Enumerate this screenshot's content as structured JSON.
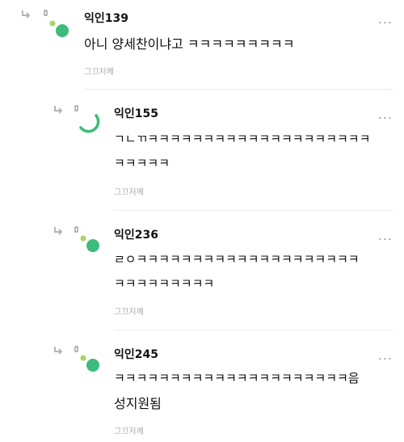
{
  "comments": [
    {
      "author": "익인139",
      "text": "아니 양세찬이냐고 ㅋㅋㅋㅋㅋㅋㅋㅋㅋ",
      "meta": "그끄저께",
      "more": "..."
    },
    {
      "author": "익인155",
      "line1": "ㄱㄴㄲㅋㅋㅋㅋㅋㅋㅋㅋㅋㅋㅋㅋㅋㅋㅋㅋㅋㅋㅋㅋ",
      "line2": "ㅋㅋㅋㅋㅋ",
      "meta": "그끄저께",
      "more": "..."
    },
    {
      "author": "익인236",
      "line1": "ㄹㅇㅋㅋㅋㅋㅋㅋㅋㅋㅋㅋㅋㅋㅋㅋㅋㅋㅋㅋㅋㅋ",
      "line2": "ㅋㅋㅋㅋㅋㅋㅋㅋㅋ",
      "meta": "그끄저께",
      "more": "..."
    },
    {
      "author": "익인245",
      "line1": "ㅋㅋㅋㅋㅋㅋㅋㅋㅋㅋㅋㅋㅋㅋㅋㅋㅋㅋㅋㅋㅋ음",
      "line2": "성지원됨",
      "meta": "그끄저께",
      "more": "..."
    }
  ],
  "colors": {
    "accent_green": "#3dbb7a",
    "accent_lime": "#a8d46a",
    "muted": "#a9a9a9"
  },
  "icons": {
    "reply": "reply-arrow-icon",
    "avatar": "green-dots-avatar",
    "more": "more-dots-icon"
  }
}
